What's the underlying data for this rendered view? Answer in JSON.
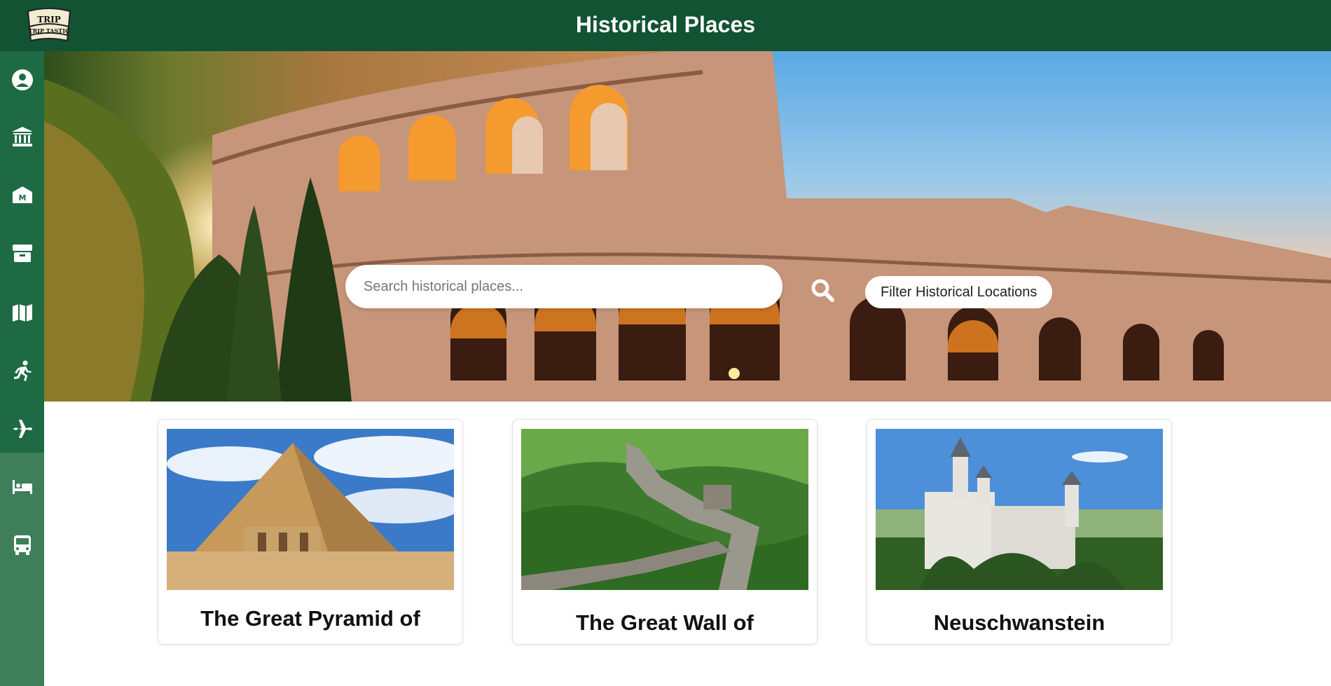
{
  "header": {
    "title": "Historical Places",
    "logo_text_top": "TRIP",
    "logo_text_bottom": "TRIP TASTIC"
  },
  "sidebar": {
    "items": [
      {
        "icon": "user-circle-icon"
      },
      {
        "icon": "museum-icon"
      },
      {
        "icon": "monument-icon"
      },
      {
        "icon": "box-icon"
      },
      {
        "icon": "map-icon"
      },
      {
        "icon": "running-person-icon"
      },
      {
        "icon": "airplane-icon"
      },
      {
        "icon": "bed-icon"
      },
      {
        "icon": "bus-icon"
      }
    ]
  },
  "search": {
    "placeholder": "Search historical places...",
    "value": ""
  },
  "filter": {
    "label": "Filter Historical Locations"
  },
  "cards": [
    {
      "title": "The Great Pyramid of"
    },
    {
      "title": "The Great Wall of"
    },
    {
      "title": "Neuschwanstein"
    }
  ],
  "colors": {
    "header_bg": "#115333",
    "sidebar_bg": "#1e6a45",
    "sidebar_lower_bg": "#3e7e58"
  }
}
